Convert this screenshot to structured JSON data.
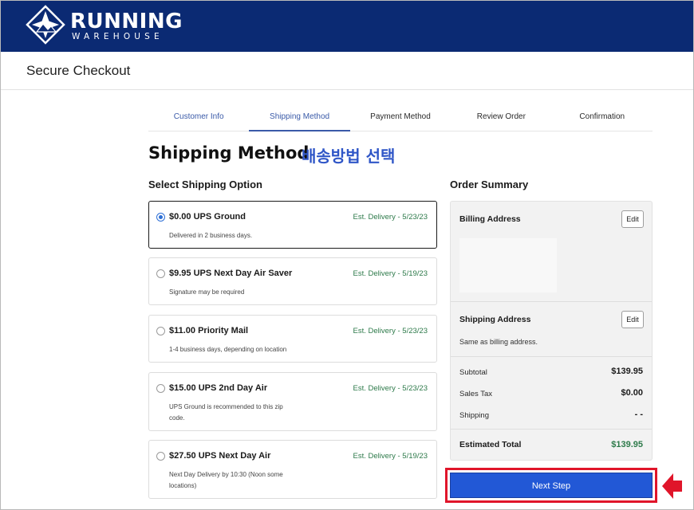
{
  "header": {
    "logo_main": "RUNNING",
    "logo_sub": "WAREHOUSE",
    "brand_color": "#0b2a73"
  },
  "checkout": {
    "title": "Secure Checkout"
  },
  "tabs": [
    {
      "label": "Customer Info"
    },
    {
      "label": "Shipping Method"
    },
    {
      "label": "Payment Method"
    },
    {
      "label": "Review Order"
    },
    {
      "label": "Confirmation"
    }
  ],
  "active_tab": "Shipping Method",
  "heading": {
    "title": "Shipping Method",
    "annotation": "배송방법 선택"
  },
  "shipping": {
    "section_title": "Select Shipping Option",
    "options": [
      {
        "title": "$0.00 UPS Ground",
        "est": "Est. Delivery - 5/23/23",
        "desc": "Delivered in 2 business days.",
        "selected": true
      },
      {
        "title": "$9.95 UPS Next Day Air Saver",
        "est": "Est. Delivery - 5/19/23",
        "desc": "Signature may be required",
        "selected": false
      },
      {
        "title": "$11.00 Priority Mail",
        "est": "Est. Delivery - 5/23/23",
        "desc": "1-4 business days, depending on location",
        "selected": false
      },
      {
        "title": "$15.00 UPS 2nd Day Air",
        "est": "Est. Delivery - 5/23/23",
        "desc": "UPS Ground is recommended to this zip code.",
        "selected": false
      },
      {
        "title": "$27.50 UPS Next Day Air",
        "est": "Est. Delivery - 5/19/23",
        "desc": "Next Day Delivery by 10:30 (Noon some locations)",
        "selected": false
      }
    ]
  },
  "summary": {
    "title": "Order Summary",
    "billing_label": "Billing Address",
    "shipping_label": "Shipping Address",
    "edit_label": "Edit",
    "shipping_same": "Same as billing address.",
    "subtotal_label": "Subtotal",
    "subtotal_value": "$139.95",
    "tax_label": "Sales Tax",
    "tax_value": "$0.00",
    "shipping_row_label": "Shipping",
    "shipping_row_value": "- -",
    "total_label": "Estimated Total",
    "total_value": "$139.95"
  },
  "next_button": {
    "label": "Next Step"
  },
  "colors": {
    "accent_blue": "#2258d6",
    "delivery_green": "#2d7a4a",
    "highlight_red": "#e0152a"
  }
}
